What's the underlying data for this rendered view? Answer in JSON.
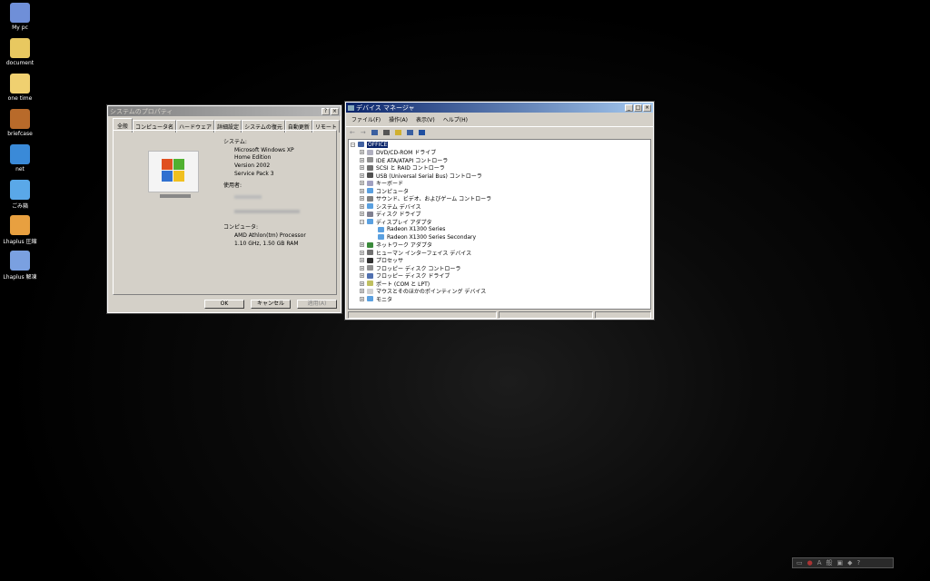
{
  "desktop_icons": [
    {
      "label": "My pc",
      "icon": "computer-icon",
      "color": "#6f8fd8"
    },
    {
      "label": "document",
      "icon": "folder-icon",
      "color": "#e8c860"
    },
    {
      "label": "one time",
      "icon": "folder-shortcut-icon",
      "color": "#f0d070"
    },
    {
      "label": "briefcase",
      "icon": "briefcase-icon",
      "color": "#b86a2a"
    },
    {
      "label": "net",
      "icon": "network-icon",
      "color": "#3a8ad8"
    },
    {
      "label": "ごみ箱",
      "icon": "recycle-bin-icon",
      "color": "#5aa8e8"
    },
    {
      "label": "Lhaplus 圧縮",
      "icon": "lhaplus-compress-icon",
      "color": "#e8a040"
    },
    {
      "label": "Lhaplus 解凍",
      "icon": "lhaplus-extract-icon",
      "color": "#7aa0e0"
    }
  ],
  "sysprops": {
    "title": "システムのプロパティ",
    "help": "?",
    "close": "×",
    "tabs": [
      "全般",
      "コンピュータ名",
      "ハードウェア",
      "詳細設定",
      "システムの復元",
      "自動更新",
      "リモート"
    ],
    "system_label": "システム:",
    "system_lines": [
      "Microsoft Windows XP",
      "Home Edition",
      "Version 2002",
      "Service Pack 3"
    ],
    "user_label": "使用者:",
    "computer_label": "コンピュータ:",
    "computer_lines": [
      "AMD Athlon(tm) Processor",
      "1.10 GHz, 1.50 GB RAM"
    ],
    "buttons": {
      "ok": "OK",
      "cancel": "キャンセル",
      "apply": "適用(A)"
    }
  },
  "devmgr": {
    "title": "デバイス マネージャ",
    "menu": [
      "ファイル(F)",
      "操作(A)",
      "表示(V)",
      "ヘルプ(H)"
    ],
    "root": "OFFICE",
    "items": [
      {
        "label": "DVD/CD-ROM ドライブ",
        "color": "#b0b0c0"
      },
      {
        "label": "IDE ATA/ATAPI コントローラ",
        "color": "#909090"
      },
      {
        "label": "SCSI と RAID コントローラ",
        "color": "#707070"
      },
      {
        "label": "USB (Universal Serial Bus) コントローラ",
        "color": "#505050"
      },
      {
        "label": "キーボード",
        "color": "#a0a0c0"
      },
      {
        "label": "コンピュータ",
        "color": "#5aa0e0"
      },
      {
        "label": "サウンド、ビデオ、およびゲーム コントローラ",
        "color": "#808080"
      },
      {
        "label": "システム デバイス",
        "color": "#5aa0e0"
      },
      {
        "label": "ディスク ドライブ",
        "color": "#808090"
      },
      {
        "label": "ディスプレイ アダプタ",
        "color": "#5aa0e0",
        "expanded": true,
        "children": [
          "Radeon X1300 Series",
          "Radeon X1300 Series Secondary"
        ]
      },
      {
        "label": "ネットワーク アダプタ",
        "color": "#3a8a3a"
      },
      {
        "label": "ヒューマン インターフェイス デバイス",
        "color": "#707070"
      },
      {
        "label": "プロセッサ",
        "color": "#303030"
      },
      {
        "label": "フロッピー ディスク コントローラ",
        "color": "#909090"
      },
      {
        "label": "フロッピー ディスク ドライブ",
        "color": "#5070b0"
      },
      {
        "label": "ポート (COM と LPT)",
        "color": "#c0c060"
      },
      {
        "label": "マウスとそのほかのポインティング デバイス",
        "color": "#d0d0d0"
      },
      {
        "label": "モニタ",
        "color": "#5aa0e0"
      }
    ]
  }
}
